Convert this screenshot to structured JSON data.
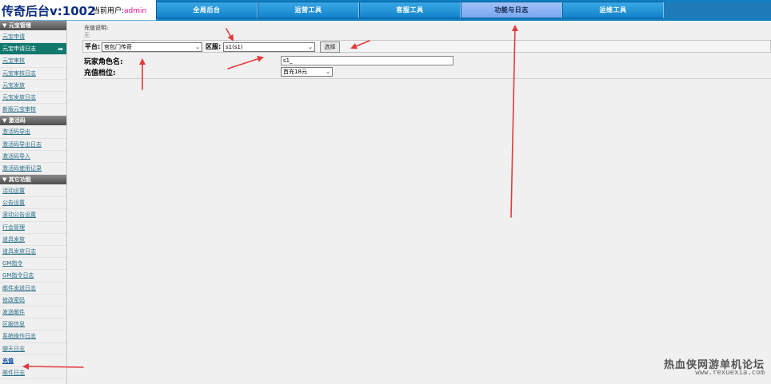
{
  "header": {
    "title": "传奇后台v:1002",
    "user_label": "当前用户:",
    "username": "admin"
  },
  "nav": {
    "tabs": [
      {
        "label": "全局后台"
      },
      {
        "label": "运营工具"
      },
      {
        "label": "客服工具"
      },
      {
        "label": "功能与日志"
      },
      {
        "label": "运维工具"
      }
    ],
    "active_index": 3
  },
  "sidebar": {
    "sections": [
      {
        "title": "▼ 元宝管理",
        "items": [
          "元宝申请",
          "元宝申请日志",
          "元宝审核",
          "元宝审核日志",
          "元宝发放",
          "元宝发放日志",
          "新版元宝审核"
        ]
      },
      {
        "title": "▼ 激活码",
        "items": [
          "激活码导出",
          "激活码导出日志",
          "激活码导入",
          "激活码使用记录"
        ]
      },
      {
        "title": "▼ 其它功能",
        "items": [
          "活动设置",
          "公告设置",
          "滚动公告设置",
          "行会管理",
          "道具发放",
          "道具发放日志",
          "GM指令",
          "GM指令日志",
          "邮件发送日志",
          "修改密码",
          "发送邮件",
          "区服信息",
          "系统操作日志",
          "聊天日志",
          "充值",
          "邮件日志"
        ]
      }
    ],
    "selected_item": "元宝申请日志"
  },
  "main": {
    "desc_title": "充值说明:",
    "desc_value": "无",
    "platform_label": "平台:",
    "platform_value": "官包门传奇",
    "zone_label": "区服:",
    "zone_value": "s1(s1)",
    "select_button": "选择",
    "role_label": "玩家角色名:",
    "role_value": "s1_",
    "tier_label": "充值档位:",
    "tier_value": "首充18元"
  },
  "watermark": {
    "line1": "热血侠网游单机论坛",
    "line2": "www.rexuexia.com"
  },
  "colors": {
    "header_blue": "#0d7fc2",
    "active_tab": "#7aa7f0",
    "sidebar_selected": "#11786e",
    "annotation_arrow": "#e23b3b"
  }
}
